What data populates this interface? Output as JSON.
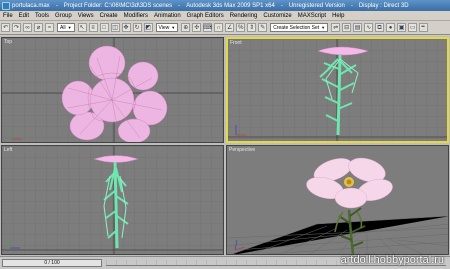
{
  "titlebar": {
    "file": "portulaca.max",
    "project": "Project Folder: C:\\06\\MC\\3d\\3DS scenes",
    "app": "Autodesk 3ds Max  2009 SP1  x64",
    "license": "Unregistered Version",
    "display": "Display : Direct 3D"
  },
  "menu": [
    "File",
    "Edit",
    "Tools",
    "Group",
    "Views",
    "Create",
    "Modifiers",
    "Animation",
    "Graph Editors",
    "Rendering",
    "Customize",
    "MAXScript",
    "Help"
  ],
  "toolbar": {
    "filter_select": "All",
    "refcoord_select": "View",
    "named_selection": "Create Selection Set"
  },
  "viewports": {
    "top": "Top",
    "front": "Front",
    "left": "Left",
    "perspective": "Perspective"
  },
  "statusbar": {
    "frame_counter": "0 / 100"
  },
  "watermark": "artdoll.hobbyportal.ru",
  "colors": {
    "viewport_bg": "#7d7d7d",
    "active_border": "#e5d93d",
    "petal_wire": "#f0a8e0",
    "stem_wire": "#6fe6b0"
  }
}
